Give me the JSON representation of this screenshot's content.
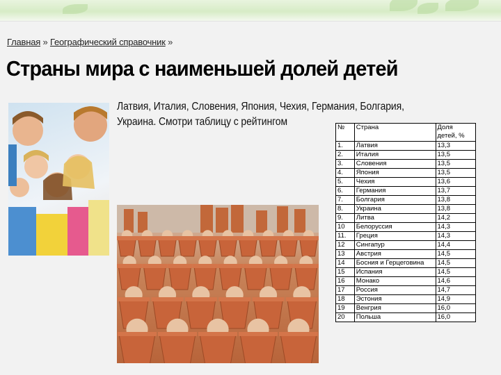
{
  "breadcrumb": {
    "home": "Главная",
    "separator1": "»",
    "section": "Географический справочник",
    "separator2": "»"
  },
  "page_title": "Страны мира с наименьшей долей детей",
  "intro_text": "Латвия,  Италия, Словения, Япония, Чехия, Германия, Болгария, Украина. Смотри таблицу с рейтингом",
  "table": {
    "headers": [
      "№",
      "Страна",
      "Доля детей, %"
    ],
    "rows": [
      [
        "1.",
        "Латвия",
        "13,3"
      ],
      [
        "2.",
        "Италия",
        "13,5"
      ],
      [
        "3.",
        "Словения",
        "13,5"
      ],
      [
        "4.",
        "Япония",
        "13,5"
      ],
      [
        "5.",
        "Чехия",
        "13,6"
      ],
      [
        "6.",
        "Германия",
        "13,7"
      ],
      [
        "7.",
        "Болгария",
        "13,8"
      ],
      [
        "8.",
        "Украина",
        "13,8"
      ],
      [
        "9.",
        "Литва",
        "14,2"
      ],
      [
        "10",
        "Белоруссия",
        "14,3"
      ],
      [
        "11.",
        "Греция",
        "14,3"
      ],
      [
        "12",
        "Сингапур",
        "14,4"
      ],
      [
        "13",
        "Австрия",
        "14,5"
      ],
      [
        "14",
        "Босния и Герцеговина",
        "14,5"
      ],
      [
        "15",
        "Испания",
        "14,5"
      ],
      [
        "16",
        "Монако",
        "14,6"
      ],
      [
        "17",
        "Россия",
        "14,7"
      ],
      [
        "18",
        "Эстония",
        "14,9"
      ],
      [
        "19",
        "Венгрия",
        "16,0"
      ],
      [
        "20",
        "Польша",
        "16,0"
      ]
    ]
  },
  "images": {
    "kids_photo": "children-group-photo",
    "pots_photo": "baby-dolls-in-clay-pots-photo"
  },
  "colors": {
    "banner_green": "#d7ecc6",
    "page_background": "#f2f2f2",
    "pot_terracotta": "#c8643a"
  }
}
